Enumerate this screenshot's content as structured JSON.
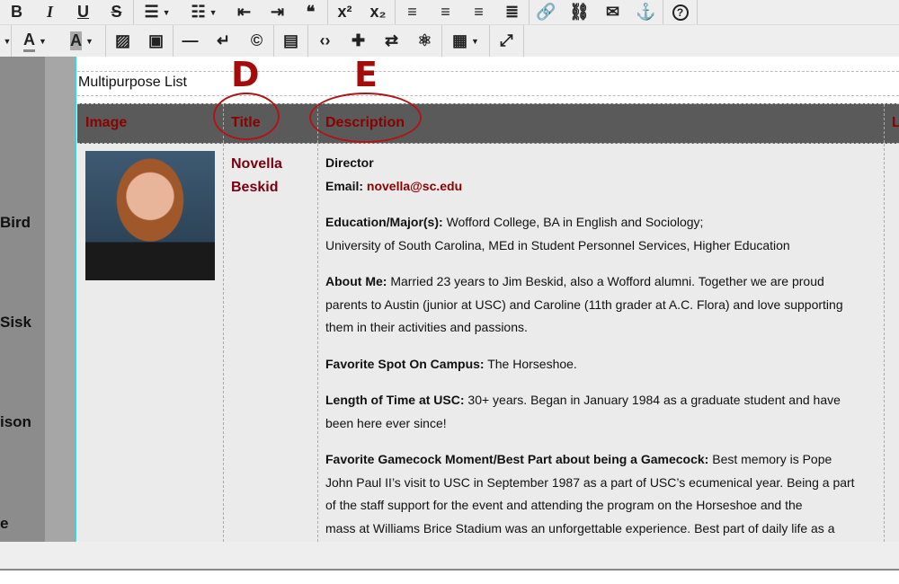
{
  "toolbar": {
    "row1": [
      {
        "name": "bold",
        "glyph": "B"
      },
      {
        "name": "italic",
        "glyph": "I"
      },
      {
        "name": "underline",
        "glyph": "U"
      },
      {
        "name": "strikethrough",
        "glyph": "S"
      },
      {
        "name": "bulleted-list",
        "glyph": "☰"
      },
      {
        "name": "numbered-list",
        "glyph": "☷"
      },
      {
        "name": "outdent",
        "glyph": "⇤"
      },
      {
        "name": "indent",
        "glyph": "⇥"
      },
      {
        "name": "blockquote",
        "glyph": "❝"
      },
      {
        "name": "superscript",
        "glyph": "x²"
      },
      {
        "name": "subscript",
        "glyph": "x₂"
      },
      {
        "name": "align-left",
        "glyph": "≡"
      },
      {
        "name": "align-center",
        "glyph": "≡"
      },
      {
        "name": "align-right",
        "glyph": "≡"
      },
      {
        "name": "justify",
        "glyph": "≣"
      },
      {
        "name": "link",
        "glyph": "🔗"
      },
      {
        "name": "unlink",
        "glyph": "⛓"
      },
      {
        "name": "email",
        "glyph": "✉"
      },
      {
        "name": "anchor",
        "glyph": "⚓"
      },
      {
        "name": "help",
        "glyph": "?"
      }
    ],
    "row2": [
      {
        "name": "text-color",
        "glyph": "A"
      },
      {
        "name": "background-color",
        "glyph": "A"
      },
      {
        "name": "image",
        "glyph": "▨"
      },
      {
        "name": "video",
        "glyph": "▣"
      },
      {
        "name": "horizontal-line",
        "glyph": "—"
      },
      {
        "name": "line-break",
        "glyph": "↵"
      },
      {
        "name": "special-character",
        "glyph": "©"
      },
      {
        "name": "template",
        "glyph": "▤"
      },
      {
        "name": "source-code",
        "glyph": "‹›"
      },
      {
        "name": "plugin",
        "glyph": "✚"
      },
      {
        "name": "repeat",
        "glyph": "⇄"
      },
      {
        "name": "atom",
        "glyph": "⚛"
      },
      {
        "name": "table",
        "glyph": "▦"
      },
      {
        "name": "fullscreen",
        "glyph": "⤢"
      }
    ]
  },
  "sidebar_names": [
    "Bird",
    "Sisk",
    "ison",
    "e"
  ],
  "list_title": "Multipurpose List",
  "headers": [
    "Image",
    "Title",
    "Description",
    "L"
  ],
  "annotations": {
    "d": "D",
    "e": "E"
  },
  "person": {
    "name_line1": "Novella",
    "name_line2": "Beskid",
    "role": "Director",
    "email_label": "Email:",
    "email": "novella@sc.edu",
    "education_label": "Education/Major(s):",
    "education": [
      "Wofford College, BA in English and Sociology;",
      "University of South Carolina, MEd in Student Personnel Services, Higher Education"
    ],
    "about_label": "About Me:",
    "about": [
      " Married 23 years to Jim Beskid, also a Wofford alumni. Together we are proud",
      "parents to Austin (junior at USC) and Caroline (11th grader at A.C. Flora) and love supporting",
      "them in their activities and passions."
    ],
    "spot_label": "Favorite Spot On Campus:",
    "spot": " The Horseshoe.",
    "length_label": "Length of Time at USC:",
    "length": [
      " 30+ years. Began in January 1984 as a graduate student and have",
      "been here ever since!"
    ],
    "moment_label": "Favorite Gamecock Moment/Best Part about being a Gamecock:",
    "moment": [
      " Best memory is Pope",
      "John Paul II’s visit to USC in September 1987 as a part of USC’s ecumenical year. Being a part",
      "of the staff support for the event and attending the program on the Horseshoe and the",
      "mass at Williams Brice Stadium was an unforgettable experience. Best part of daily life as a"
    ]
  },
  "colors": {
    "accent": "#8b0000",
    "header_bg": "#5a5a5a",
    "annotation": "#a50b0b"
  }
}
